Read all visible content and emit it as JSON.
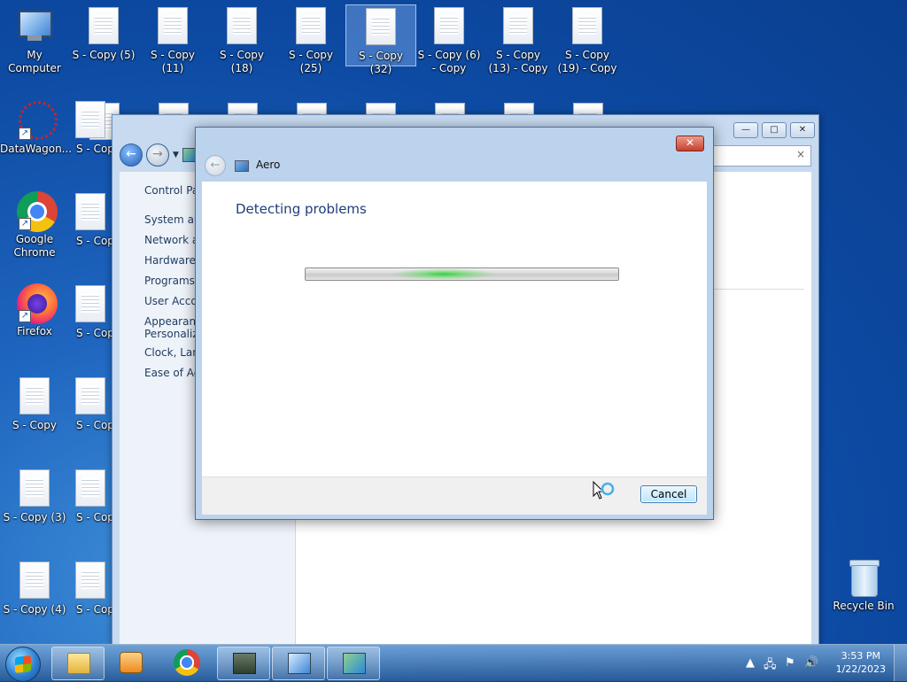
{
  "desktop": {
    "icons": [
      {
        "label": "My Computer"
      },
      {
        "label": "S - Copy (5)"
      },
      {
        "label": "S - Copy (11)"
      },
      {
        "label": "S - Copy (18)"
      },
      {
        "label": "S - Copy (25)"
      },
      {
        "label": "S - Copy (32)"
      },
      {
        "label": "S - Copy (6) - Copy"
      },
      {
        "label": "S - Copy (13) - Copy"
      },
      {
        "label": "S - Copy (19) - Copy"
      },
      {
        "label": "DataWagon..."
      },
      {
        "label": "S - Cop"
      },
      {
        "label": "Google Chrome"
      },
      {
        "label": "S - Cop"
      },
      {
        "label": "Firefox"
      },
      {
        "label": "S - Cop"
      },
      {
        "label": "S - Copy"
      },
      {
        "label": "S - Cop"
      },
      {
        "label": "S - Copy (3)"
      },
      {
        "label": "S - Cop"
      },
      {
        "label": "S - Copy (4)"
      },
      {
        "label": "S - Cop"
      },
      {
        "label": "Recycle Bin"
      }
    ]
  },
  "explorer": {
    "left_items": [
      "Control Par",
      "System and",
      "Network ar",
      "Hardware a",
      "Programs",
      "User Accou",
      "Appearanc",
      "Personaliza",
      "Clock, Lang",
      "Ease of Acc"
    ],
    "address_close": "×",
    "buttons": {
      "minimize": "—",
      "maximize": "□",
      "close": "✕"
    }
  },
  "dialog": {
    "app_title": "Aero",
    "heading": "Detecting problems",
    "close_label": "✕",
    "cancel_label": "Cancel",
    "progress": {
      "state": "indeterminate"
    }
  },
  "taskbar": {
    "apps": [
      {
        "name": "explorer-icon",
        "active": true
      },
      {
        "name": "media-player-icon",
        "active": false
      },
      {
        "name": "chrome-icon",
        "active": false
      },
      {
        "name": "network-monitor-icon",
        "active": true
      },
      {
        "name": "control-panel-icon",
        "active": true
      },
      {
        "name": "troubleshooter-icon",
        "active": true
      }
    ],
    "clock": {
      "time": "3:53 PM",
      "date": "1/22/2023"
    }
  },
  "colors": {
    "heading": "#1e3e7a",
    "progress_glow": "#28d23c",
    "desktop": "#1f66c0"
  }
}
